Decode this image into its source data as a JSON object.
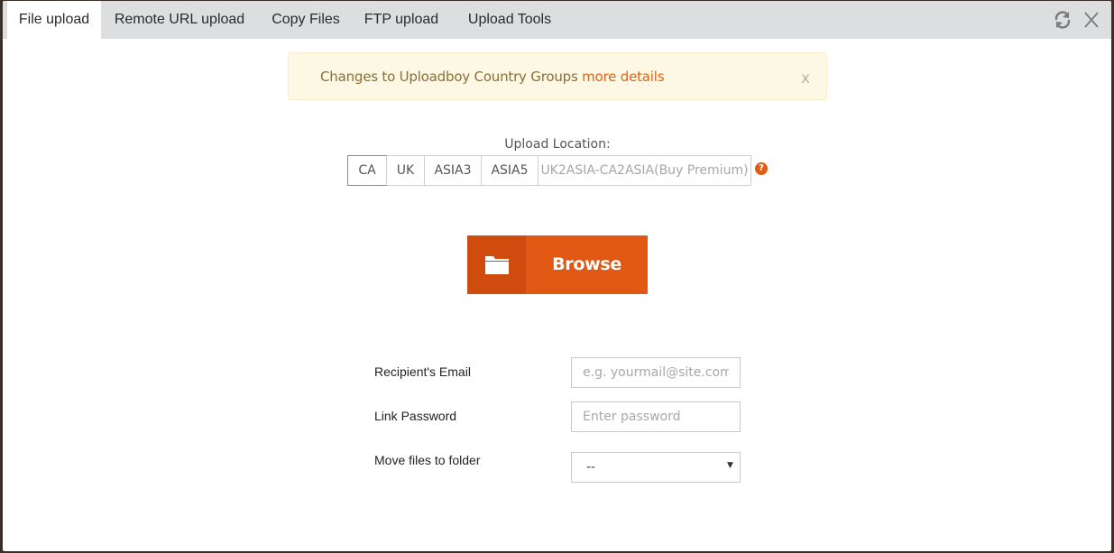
{
  "tabs": [
    {
      "label": "File upload",
      "active": true
    },
    {
      "label": "Remote URL upload",
      "active": false
    },
    {
      "label": "Copy Files",
      "active": false
    },
    {
      "label": "FTP upload",
      "active": false
    },
    {
      "label": "Upload Tools",
      "active": false
    }
  ],
  "toolbar": {
    "refresh_icon": "refresh-icon",
    "close_label": "X"
  },
  "notice": {
    "text": "Changes to Uploadboy Country Groups ",
    "link": "more details",
    "close": "x"
  },
  "upload_location": {
    "label": "Upload Location:",
    "options": [
      "CA",
      "UK",
      "ASIA3",
      "ASIA5",
      "UK2ASIA-CA2ASIA(Buy Premium)"
    ],
    "help_icon": "?"
  },
  "browse": {
    "label": "Browse",
    "icon": "folder-icon"
  },
  "form": {
    "email_label": "Recipient's Email",
    "email_placeholder": "e.g. yourmail@site.com",
    "password_label": "Link Password",
    "password_placeholder": "Enter password",
    "folder_label": "Move files to folder",
    "folder_value": "--"
  },
  "colors": {
    "accent": "#e05814",
    "accent_dark": "#cf4b0e",
    "notice_bg": "#fcf8e3",
    "tabbar_bg": "#dddee0"
  }
}
